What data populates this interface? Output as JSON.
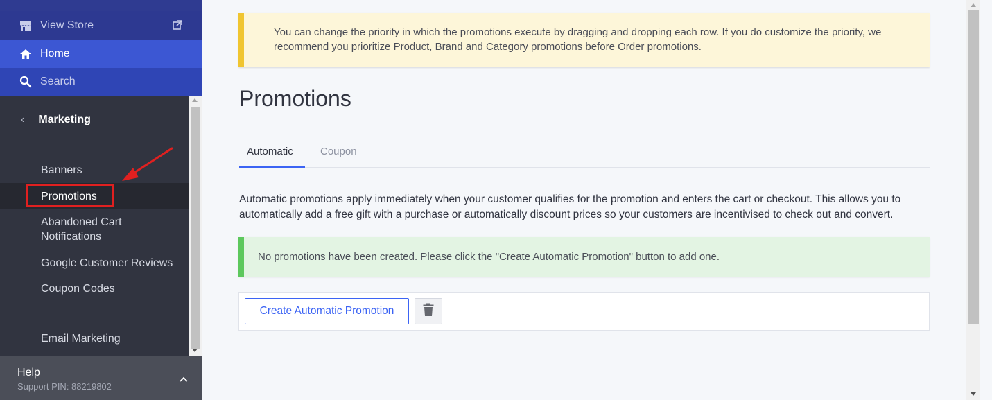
{
  "sidebar": {
    "view_store": "View Store",
    "home": "Home",
    "search": "Search",
    "section_title": "Marketing",
    "items": [
      {
        "label": "Banners"
      },
      {
        "label": "Promotions",
        "active": true
      },
      {
        "label": "Abandoned Cart Notifications"
      },
      {
        "label": "Google Customer Reviews"
      },
      {
        "label": "Coupon Codes"
      },
      {
        "label": "Email Marketing"
      }
    ],
    "help_title": "Help",
    "support_pin": "Support PIN: 88219802"
  },
  "main": {
    "notice": "You can change the priority in which the promotions execute by dragging and dropping each row. If you do customize the priority, we recommend you prioritize Product, Brand and Category promotions before Order promotions.",
    "title": "Promotions",
    "tabs": [
      {
        "label": "Automatic",
        "active": true
      },
      {
        "label": "Coupon",
        "active": false
      }
    ],
    "description": "Automatic promotions apply immediately when your customer qualifies for the promotion and enters the cart or checkout. This allows you to automatically add a free gift with a purchase or automatically discount prices so your customers are incentivised to check out and convert.",
    "empty_message": "No promotions have been created. Please click the \"Create Automatic Promotion\" button to add one.",
    "create_button": "Create Automatic Promotion"
  },
  "icons": {
    "store": "store-icon",
    "external": "external-link-icon",
    "home": "home-icon",
    "search": "search-icon",
    "back": "chevron-left-icon",
    "help": "chevron-up-icon",
    "trash": "trash-icon"
  },
  "colors": {
    "accent": "#3c64f4",
    "sidebar": "#313440",
    "annotation": "#e02020"
  }
}
